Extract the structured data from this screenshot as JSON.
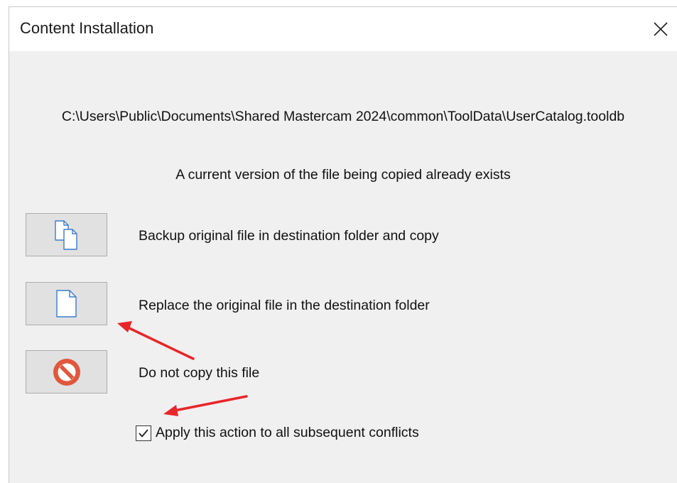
{
  "window": {
    "title": "Content Installation"
  },
  "content": {
    "path": "C:\\Users\\Public\\Documents\\Shared Mastercam 2024\\common\\ToolData\\UserCatalog.tooldb",
    "message": "A current version of the file being copied already exists"
  },
  "options": [
    {
      "label": "Backup original file in destination folder and copy",
      "icon": "copy-files-icon"
    },
    {
      "label": "Replace the original file in the destination folder",
      "icon": "file-icon"
    },
    {
      "label": "Do not copy this file",
      "icon": "no-entry-icon"
    }
  ],
  "apply_all": {
    "label": "Apply this action to all subsequent conflicts",
    "checked": true
  },
  "colors": {
    "dialog_bg": "#f0f0f0",
    "annotation_arrow": "#e8262a",
    "no_entry_icon": "#e0573c"
  }
}
